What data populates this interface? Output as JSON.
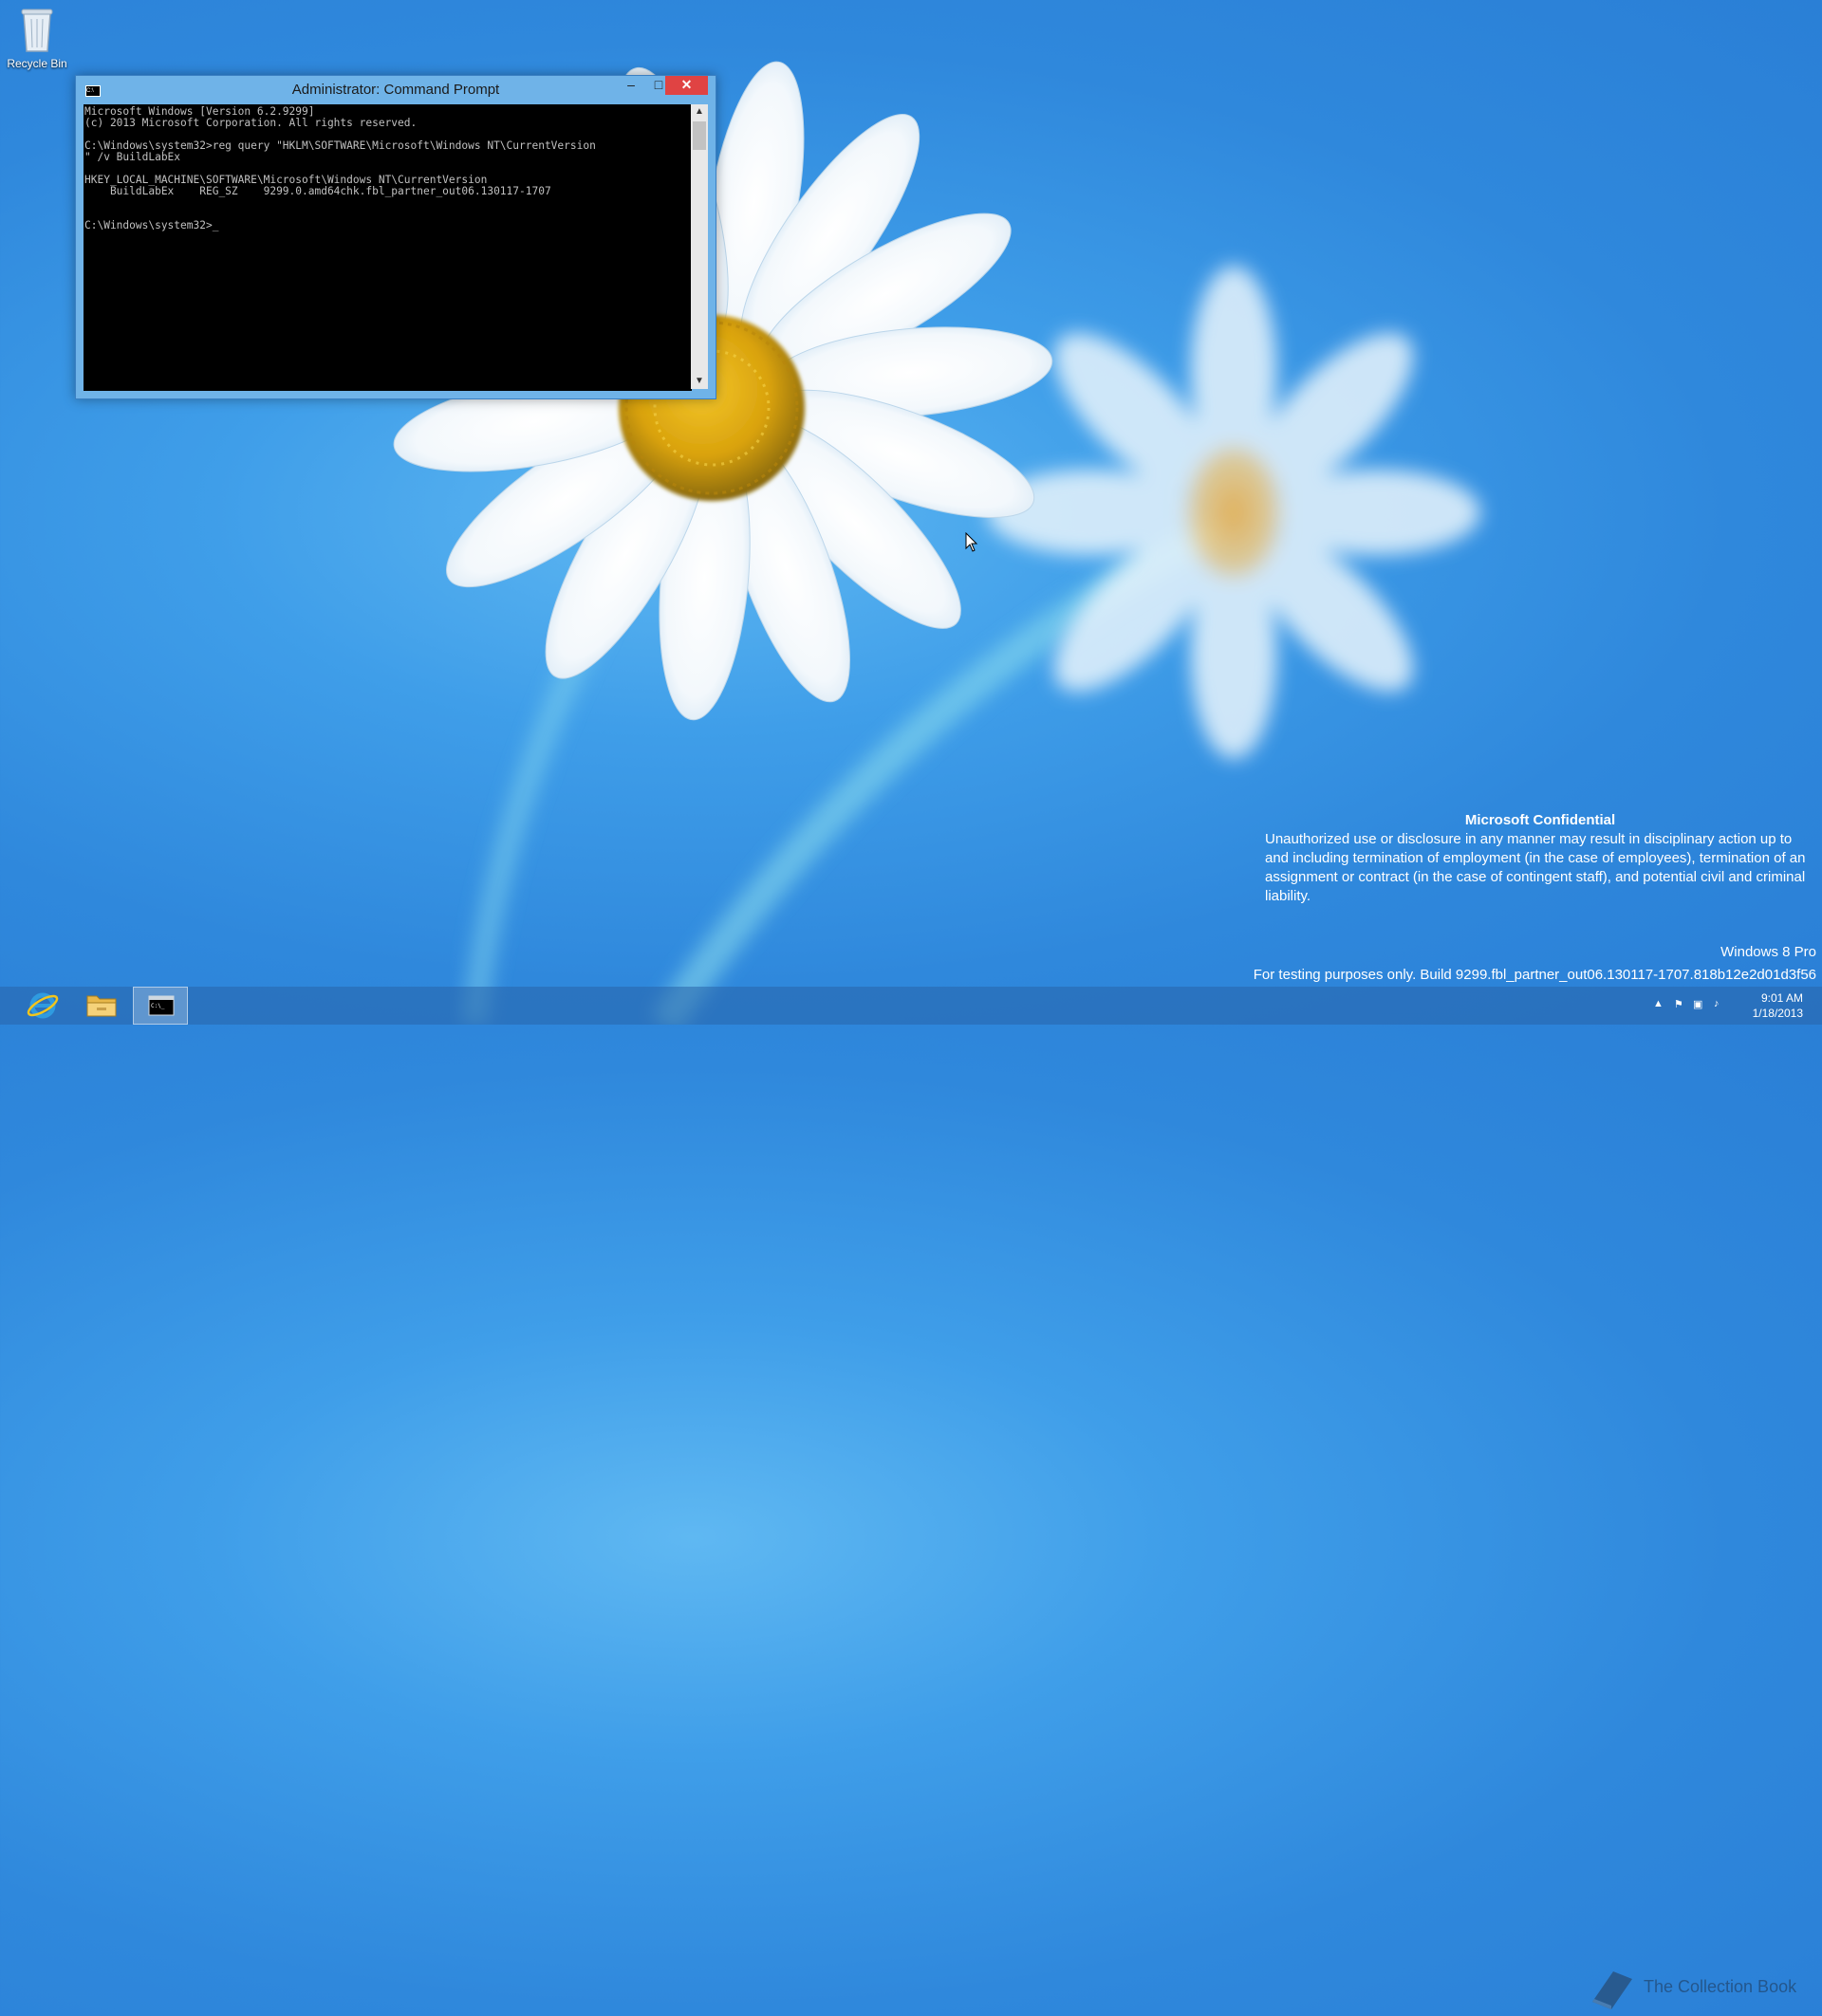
{
  "desktop": {
    "recycle_bin_label": "Recycle Bin"
  },
  "cmd_window": {
    "title": "Administrator: Command Prompt",
    "controls": {
      "minimize": "–",
      "maximize": "□",
      "close": "✕"
    },
    "console_lines": [
      "Microsoft Windows [Version 6.2.9299]",
      "(c) 2013 Microsoft Corporation. All rights reserved.",
      "",
      "C:\\Windows\\system32>reg query \"HKLM\\SOFTWARE\\Microsoft\\Windows NT\\CurrentVersion",
      "\" /v BuildLabEx",
      "",
      "HKEY_LOCAL_MACHINE\\SOFTWARE\\Microsoft\\Windows NT\\CurrentVersion",
      "    BuildLabEx    REG_SZ    9299.0.amd64chk.fbl_partner_out06.130117-1707",
      "",
      "",
      "C:\\Windows\\system32>_"
    ],
    "scroll_up": "▲",
    "scroll_down": "▼"
  },
  "overlay": {
    "confidential_title": "Microsoft Confidential",
    "confidential_text": "Unauthorized use or disclosure in any manner may result in disciplinary action up to and including termination of employment (in the case of employees), termination of an assignment or contract (in the case of contingent staff), and potential civil and criminal liability.",
    "edition": "Windows 8 Pro",
    "build": "For testing purposes only. Build 9299.fbl_partner_out06.130117-1707.818b12e2d01d3f56"
  },
  "taskbar": {
    "pinned": [
      {
        "icon": "internet-explorer-icon"
      },
      {
        "icon": "file-explorer-icon"
      },
      {
        "icon": "command-prompt-icon"
      }
    ],
    "tray": {
      "show_hidden": "▲",
      "time": "9:01 AM",
      "date": "1/18/2013"
    }
  },
  "watermark_text": "The Collection Book",
  "colors": {
    "accent": "#2f88dc",
    "close_button": "#e04343",
    "window_frame": "#6fb3e8"
  }
}
